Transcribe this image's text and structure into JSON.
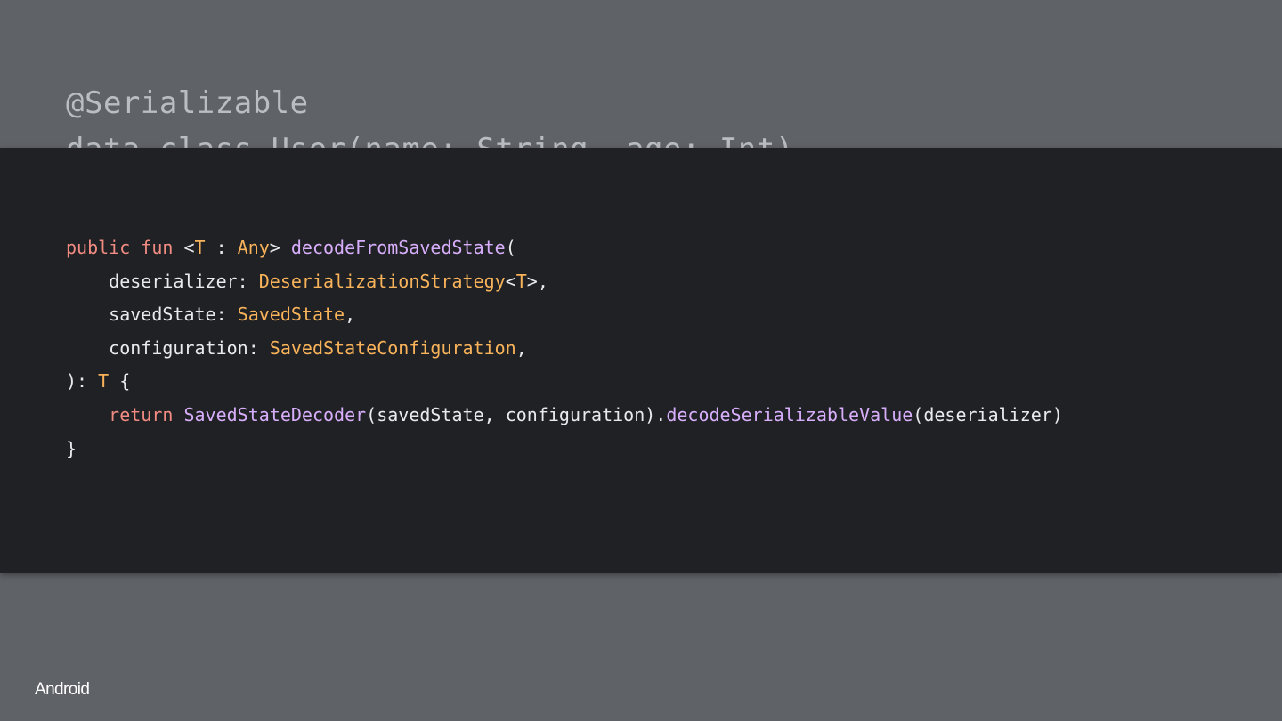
{
  "background_code": {
    "line1": "@Serializable",
    "line2": "data class User(name: String, age: Int)"
  },
  "code": {
    "lines": [
      [
        {
          "t": "public fun ",
          "c": "kw"
        },
        {
          "t": "<",
          "c": "plain"
        },
        {
          "t": "T",
          "c": "type"
        },
        {
          "t": " : ",
          "c": "plain"
        },
        {
          "t": "Any",
          "c": "type"
        },
        {
          "t": "> ",
          "c": "plain"
        },
        {
          "t": "decodeFromSavedState",
          "c": "fn"
        },
        {
          "t": "(",
          "c": "plain"
        }
      ],
      [
        {
          "t": "    deserializer: ",
          "c": "plain"
        },
        {
          "t": "DeserializationStrategy",
          "c": "type"
        },
        {
          "t": "<",
          "c": "plain"
        },
        {
          "t": "T",
          "c": "type"
        },
        {
          "t": ">,",
          "c": "plain"
        }
      ],
      [
        {
          "t": "    savedState: ",
          "c": "plain"
        },
        {
          "t": "SavedState",
          "c": "type"
        },
        {
          "t": ",",
          "c": "plain"
        }
      ],
      [
        {
          "t": "    configuration: ",
          "c": "plain"
        },
        {
          "t": "SavedStateConfiguration",
          "c": "type"
        },
        {
          "t": ",",
          "c": "plain"
        }
      ],
      [
        {
          "t": "): ",
          "c": "plain"
        },
        {
          "t": "T",
          "c": "type"
        },
        {
          "t": " {",
          "c": "plain"
        }
      ],
      [
        {
          "t": "    ",
          "c": "plain"
        },
        {
          "t": "return ",
          "c": "kw"
        },
        {
          "t": "SavedStateDecoder",
          "c": "fn"
        },
        {
          "t": "(savedState, configuration).",
          "c": "plain"
        },
        {
          "t": "decodeSerializableValue",
          "c": "fn"
        },
        {
          "t": "(deserializer)",
          "c": "plain"
        }
      ],
      [
        {
          "t": "}",
          "c": "plain"
        }
      ]
    ]
  },
  "footer": {
    "logo_text": "Android"
  },
  "colors": {
    "background": "#5f6267",
    "panel": "#202124",
    "keyword": "#f28b82",
    "type": "#f9b35a",
    "function": "#d7aefb",
    "plain": "#e8eaed"
  }
}
